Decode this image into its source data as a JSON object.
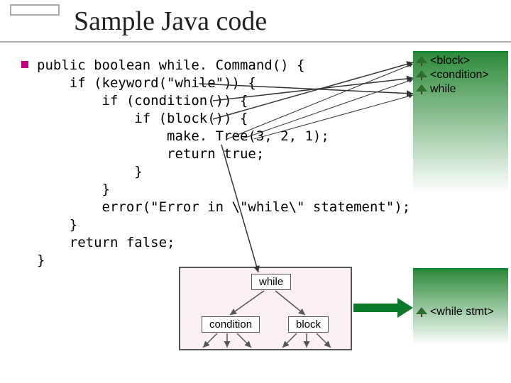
{
  "title": "Sample Java code",
  "code_lines": {
    "l0": "public boolean while. Command() {",
    "l1": "    if (keyword(\"while\")) {",
    "l2": "        if (condition()) {",
    "l3": "            if (block()) {",
    "l4": "                make. Tree(3, 2, 1);",
    "l5": "                return true;",
    "l6": "            }",
    "l7": "        }",
    "l8": "        error(\"Error in \\\"while\\\" statement\");",
    "l9": "    }",
    "l10": "    return false;",
    "l11": "}"
  },
  "stack_items": {
    "s0": "<block>",
    "s1": "<condition>",
    "s2": "while"
  },
  "result_item": "<while stmt>",
  "diagram": {
    "root": "while",
    "left": "condition",
    "right": "block"
  }
}
